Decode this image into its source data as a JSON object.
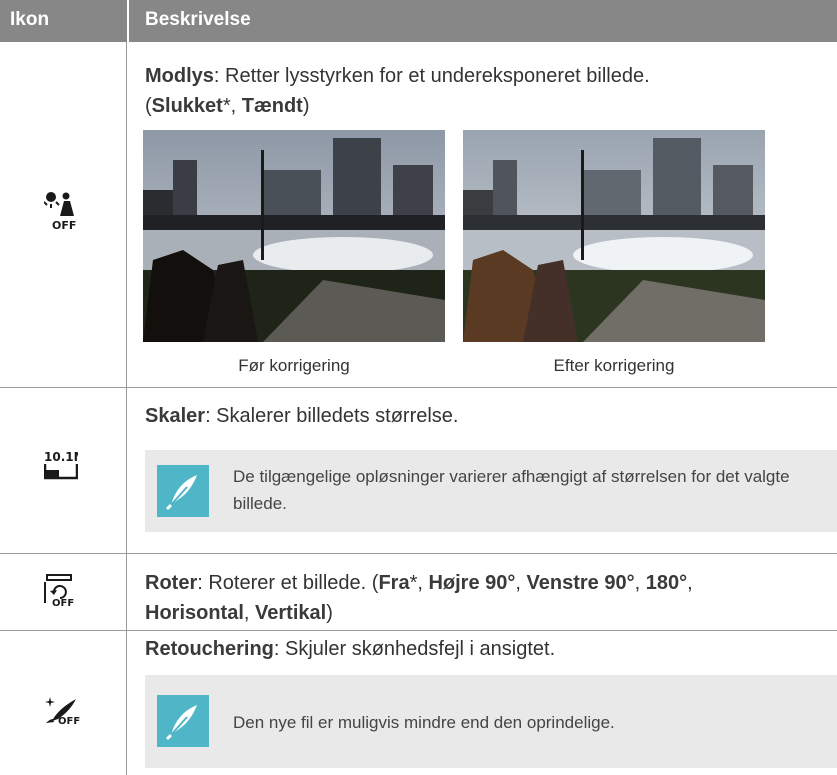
{
  "header": {
    "col_icon": "Ikon",
    "col_desc": "Beskrivelse"
  },
  "rows": [
    {
      "icon": "backlight-off-icon",
      "title": "Modlys",
      "desc": ": Retter lysstyrken for et undereksponeret billede.",
      "options_open": "(",
      "opt1": "Slukket",
      "opt1_mark": "*, ",
      "opt2": "Tændt",
      "options_close": ")",
      "caption_before": "Før korrigering",
      "caption_after": "Efter korrigering"
    },
    {
      "icon": "resize-10m-icon",
      "icon_text": "10.1M",
      "title": "Skaler",
      "desc": ": Skalerer billedets størrelse.",
      "note": "De tilgængelige opløsninger varierer afhængigt af størrelsen for det valgte billede."
    },
    {
      "icon": "rotate-off-icon",
      "icon_text": "OFF",
      "title": "Roter",
      "desc": ": Roterer et billede. (",
      "opt1": "Fra",
      "opt1_mark": "*, ",
      "opt2": "Højre 90°",
      "sep": ", ",
      "opt3": "Venstre 90°",
      "opt4": "180°",
      "opt5": "Horisontal",
      "opt6": "Vertikal",
      "close": ")"
    },
    {
      "icon": "retouch-off-icon",
      "icon_text": "OFF",
      "title": "Retouchering",
      "desc": ": Skjuler skønhedsfejl i ansigtet.",
      "note": "Den nye fil er muligvis mindre end den oprindelige."
    }
  ],
  "colors": {
    "header_bg": "#878787",
    "note_bg": "#e9e9e9",
    "note_icon_bg": "#4fb6c7"
  }
}
